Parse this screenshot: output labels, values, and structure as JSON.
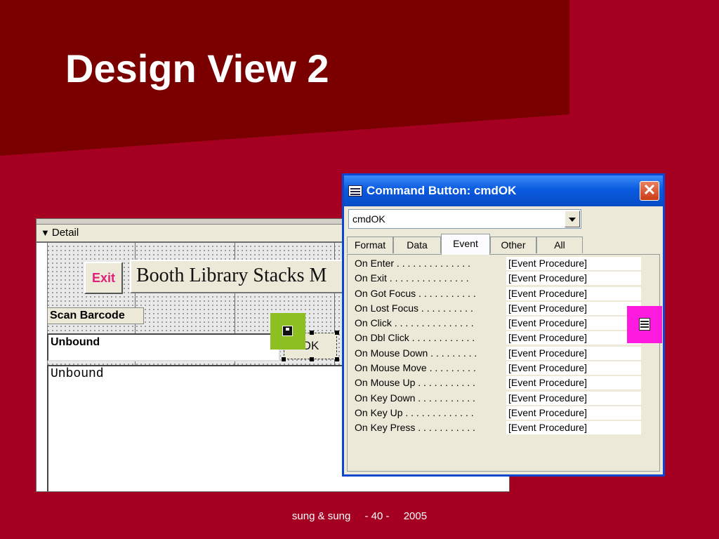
{
  "slide": {
    "title": "Design View 2",
    "footer": {
      "author": "sung & sung",
      "page": "- 40 -",
      "year": "2005"
    }
  },
  "colors": {
    "background": "#A50021",
    "band": "#7A0000",
    "accent_green": "#8CBF1F",
    "accent_magenta": "#FF1ADF",
    "xp_blue": "#0A5AE0"
  },
  "form_design": {
    "section_label": "Detail",
    "exit_button": "Exit",
    "title_label": "Booth Library Stacks M",
    "scan_label": "Scan Barcode",
    "text_box_1": "Unbound",
    "text_box_2": "Unbound",
    "ok_button": "OK"
  },
  "property_sheet": {
    "title": "Command Button: cmdOK",
    "close_icon": "close-icon",
    "object_combo": "cmdOK",
    "tabs": [
      {
        "label": "Format",
        "active": false
      },
      {
        "label": "Data",
        "active": false
      },
      {
        "label": "Event",
        "active": true
      },
      {
        "label": "Other",
        "active": false
      },
      {
        "label": "All",
        "active": false
      }
    ],
    "properties": [
      {
        "name": "On Enter . . . . . . . . . . . . . .",
        "value": "[Event Procedure]"
      },
      {
        "name": "On Exit . . . . . . . . . . . . . . .",
        "value": "[Event Procedure]"
      },
      {
        "name": "On Got Focus . . . . . . . . . . .",
        "value": "[Event Procedure]"
      },
      {
        "name": "On Lost Focus . . . . . . . . . .",
        "value": "[Event Procedure]"
      },
      {
        "name": "On Click . . . . . . . . . . . . . . .",
        "value": "[Event Procedure]"
      },
      {
        "name": "On Dbl Click . . . . . . . . . . . .",
        "value": "[Event Procedure]"
      },
      {
        "name": "On Mouse Down . . . . . . . . .",
        "value": "[Event Procedure]"
      },
      {
        "name": "On Mouse Move . . . . . . . . .",
        "value": "[Event Procedure]"
      },
      {
        "name": "On Mouse Up . . . . . . . . . . .",
        "value": "[Event Procedure]"
      },
      {
        "name": "On Key Down . . . . . . . . . . .",
        "value": "[Event Procedure]"
      },
      {
        "name": "On Key Up . . . . . . . . . . . . .",
        "value": "[Event Procedure]"
      },
      {
        "name": "On Key Press . . . . . . . . . . .",
        "value": "[Event Procedure]"
      }
    ]
  }
}
